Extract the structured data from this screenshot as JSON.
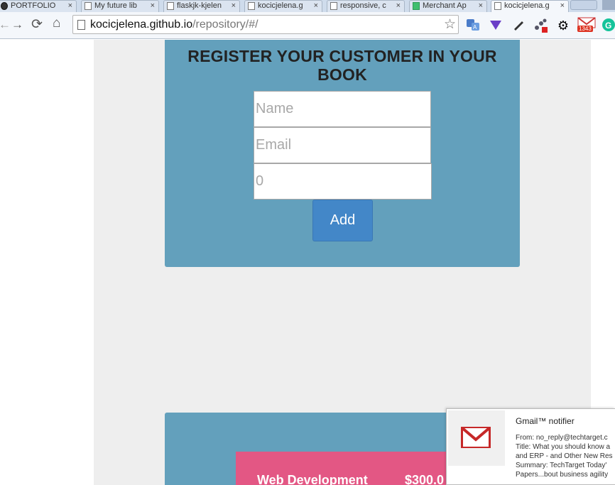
{
  "browser": {
    "tabs": [
      {
        "title": "PORTFOLIO",
        "icon": "dark"
      },
      {
        "title": "My future lib",
        "icon": "page"
      },
      {
        "title": "flaskjk-kjelen",
        "icon": "page"
      },
      {
        "title": "kocicjelena.g",
        "icon": "page"
      },
      {
        "title": "responsive, c",
        "icon": "page"
      },
      {
        "title": "Merchant Ap",
        "icon": "green"
      },
      {
        "title": "kocicjelena.g",
        "icon": "page"
      }
    ],
    "close_glyph": "×",
    "nav": {
      "back": "←",
      "forward": "→",
      "reload": "⟳",
      "home": "⌂"
    },
    "url_host": "kocicjelena.github.io",
    "url_path": "/repository/#/",
    "star": "☆",
    "gmail_badge": "1343"
  },
  "register": {
    "title": "REGISTER YOUR CUSTOMER IN YOUR BOOK",
    "name_placeholder": "Name",
    "email_placeholder": "Email",
    "number_placeholder": "0",
    "add_label": "Add"
  },
  "pricing": {
    "service": "Web Development",
    "amount": "$300.0"
  },
  "notifier": {
    "title": "Gmail™ notifier",
    "lines": [
      "From: no_reply@techtarget.c",
      "Title: What you should know a",
      "and ERP - and Other New Res",
      "Summary: TechTarget Today'",
      "Papers...bout business agility"
    ]
  },
  "colors": {
    "panel": "#63a0bc",
    "button": "#4387c8",
    "card": "#e35784",
    "column": "#eeeeee"
  }
}
